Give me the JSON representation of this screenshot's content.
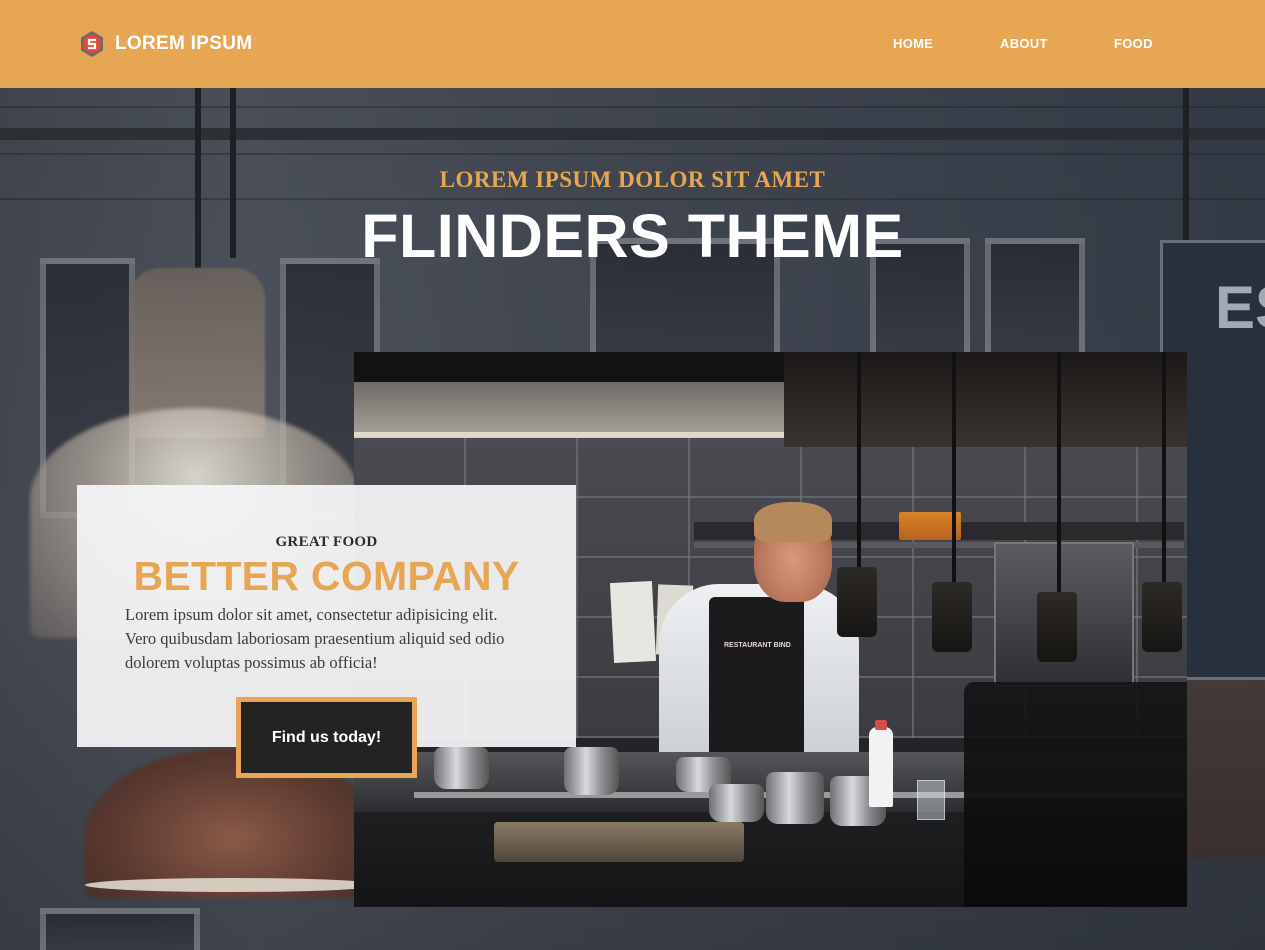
{
  "header": {
    "brand_name": "LOREM IPSUM",
    "logo_icon": "hexagon-s-logo",
    "nav": [
      {
        "label": "HOME"
      },
      {
        "label": "ABOUT"
      },
      {
        "label": "FOOD"
      }
    ]
  },
  "hero": {
    "kicker": "LOREM IPSUM DOLOR SIT AMET",
    "title": "FLINDERS THEME",
    "sign_text": "ES"
  },
  "photo": {
    "apron_text": "RESTAURANT BIND"
  },
  "feature": {
    "eyebrow": "GREAT FOOD",
    "title": "BETTER COMPANY",
    "body": "Lorem ipsum dolor sit amet, consectetur adipisicing elit. Vero quibusdam laboriosam praesentium aliquid sed odio dolorem voluptas possimus ab officia!",
    "cta_label": "Find us today!"
  },
  "colors": {
    "accent": "#e6a654",
    "dark": "#232323",
    "header_bg": "#e6a654",
    "card_bg": "#f4f4f6"
  }
}
